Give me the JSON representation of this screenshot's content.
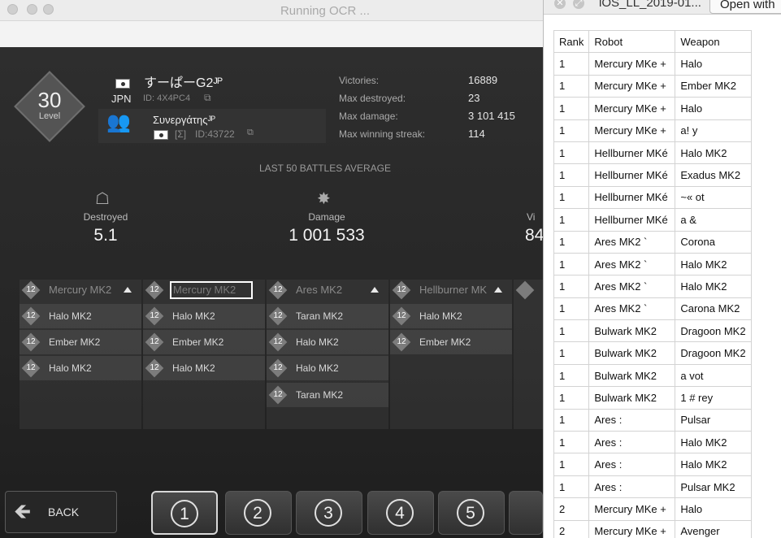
{
  "window": {
    "title": "Running OCR ..."
  },
  "player": {
    "level": "30",
    "level_label": "Level",
    "name": "すーぱーG2ᴶᴾ",
    "country": "JPN",
    "id": "ID: 4X4PC4",
    "clan_name": "Συνεργάτηςᴶᴾ",
    "clan_tag": "[Σ]",
    "clan_id": "ID:43722"
  },
  "stats": [
    {
      "label": "Victories:",
      "value": "16889"
    },
    {
      "label": "Max destroyed:",
      "value": "23"
    },
    {
      "label": "Max damage:",
      "value": "3 101 415"
    },
    {
      "label": "Max winning streak:",
      "value": "114"
    }
  ],
  "averages": {
    "title": "LAST 50 BATTLES AVERAGE",
    "destroyed_label": "Destroyed",
    "destroyed_value": "5.1",
    "damage_label": "Damage",
    "damage_value": "1 001 533",
    "partial_label": "Vi",
    "partial_value": "84"
  },
  "robots": [
    {
      "level": "12",
      "name": "Mercury MK2",
      "weapons": [
        "Halo MK2",
        "Ember MK2",
        "Halo MK2"
      ]
    },
    {
      "level": "12",
      "name": "Mercury MK2",
      "weapons": [
        "Halo MK2",
        "Ember MK2",
        "Halo MK2"
      ]
    },
    {
      "level": "12",
      "name": "Ares MK2",
      "weapons": [
        "Taran MK2",
        "Halo MK2",
        "Halo MK2",
        "Taran MK2"
      ]
    },
    {
      "level": "12",
      "name": "Hellburner MK",
      "weapons": [
        "Halo MK2",
        "Ember MK2"
      ]
    }
  ],
  "weapon_level": "12",
  "nav": {
    "back_label": "BACK",
    "pages": [
      "1",
      "2",
      "3",
      "4",
      "5"
    ]
  },
  "ocr_window": {
    "title": "iOS_LL_2019-01...",
    "open_with": "Open with",
    "headers": [
      "Rank",
      "Robot",
      "Weapon"
    ],
    "rows": [
      [
        "1",
        "Mercury MKe +",
        "Halo"
      ],
      [
        "1",
        "Mercury MKe +",
        "Ember MK2"
      ],
      [
        "1",
        "Mercury MKe +",
        "Halo"
      ],
      [
        "1",
        "Mercury MKe +",
        "a! y"
      ],
      [
        "1",
        "Hellburner MKé",
        "Halo MK2"
      ],
      [
        "1",
        "Hellburner MKé",
        "Exadus MK2"
      ],
      [
        "1",
        "Hellburner MKé",
        "~« ot"
      ],
      [
        "1",
        "Hellburner MKé",
        "a &"
      ],
      [
        "1",
        "Ares MK2 `",
        "Corona"
      ],
      [
        "1",
        "Ares MK2 `",
        "Halo MK2"
      ],
      [
        "1",
        "Ares MK2 `",
        "Halo MK2"
      ],
      [
        "1",
        "Ares MK2 `",
        "Carona MK2"
      ],
      [
        "1",
        "Bulwark MK2",
        "Dragoon MK2"
      ],
      [
        "1",
        "Bulwark MK2",
        "Dragoon MK2"
      ],
      [
        "1",
        "Bulwark MK2",
        "a vot"
      ],
      [
        "1",
        "Bulwark MK2",
        "1 # rey"
      ],
      [
        "1",
        "Ares :",
        "Pulsar"
      ],
      [
        "1",
        "Ares :",
        "Halo MK2"
      ],
      [
        "1",
        "Ares :",
        "Halo MK2"
      ],
      [
        "1",
        "Ares :",
        "Pulsar MK2"
      ],
      [
        "2",
        "Mercury MKe +",
        "Halo"
      ],
      [
        "2",
        "Mercury MKe +",
        "Avenger"
      ]
    ]
  }
}
